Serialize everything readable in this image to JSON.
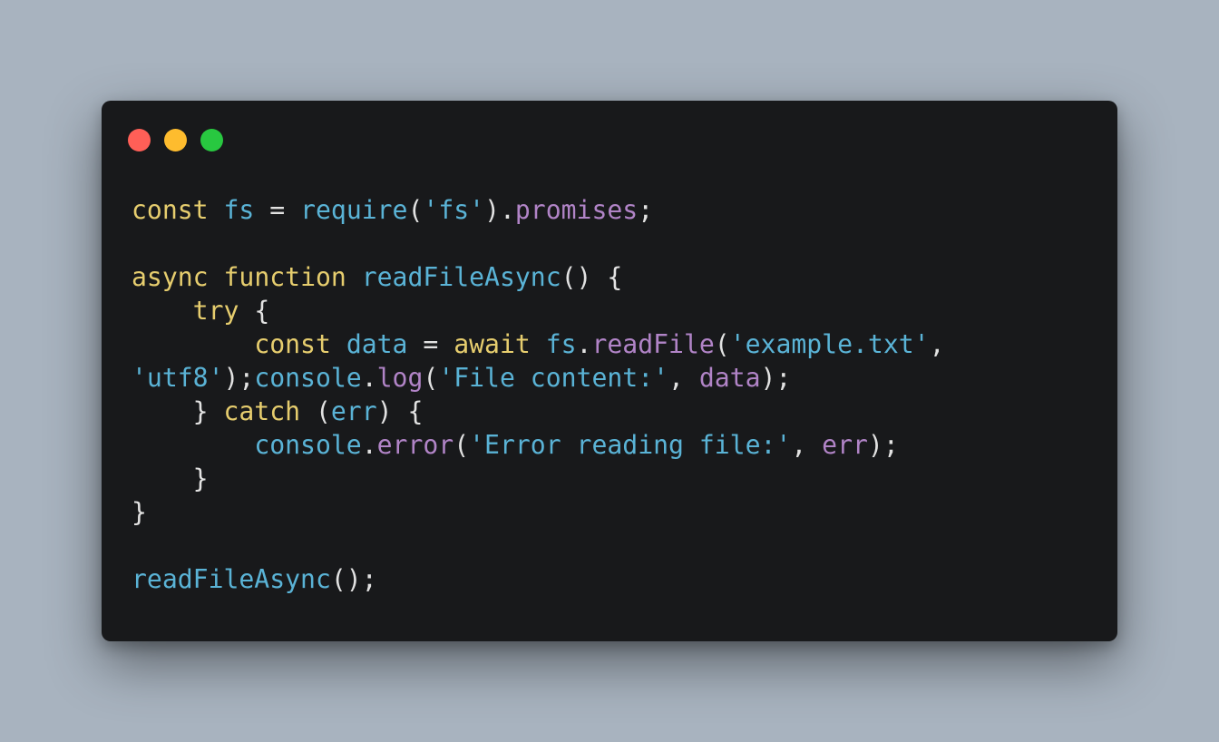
{
  "window": {
    "buttons": [
      {
        "name": "close",
        "color": "#ff5f57"
      },
      {
        "name": "minimize",
        "color": "#febc2e"
      },
      {
        "name": "zoom",
        "color": "#28c840"
      }
    ]
  },
  "colors": {
    "background": "#a8b3bf",
    "window": "#18191b",
    "keyword": "#e6cd6e",
    "identifier": "#5ab3d6",
    "property": "#b184c7",
    "punctuation": "#e2e2e2"
  },
  "code": {
    "lines": [
      [
        {
          "t": "const",
          "c": "kw"
        },
        {
          "t": " ",
          "c": "p"
        },
        {
          "t": "fs",
          "c": "id"
        },
        {
          "t": " = ",
          "c": "p"
        },
        {
          "t": "require",
          "c": "id"
        },
        {
          "t": "(",
          "c": "p"
        },
        {
          "t": "'fs'",
          "c": "id"
        },
        {
          "t": ").",
          "c": "p"
        },
        {
          "t": "promises",
          "c": "prop"
        },
        {
          "t": ";",
          "c": "p"
        }
      ],
      [],
      [
        {
          "t": "async",
          "c": "kw"
        },
        {
          "t": " ",
          "c": "p"
        },
        {
          "t": "function",
          "c": "kw"
        },
        {
          "t": " ",
          "c": "p"
        },
        {
          "t": "readFileAsync",
          "c": "id"
        },
        {
          "t": "() {",
          "c": "p"
        }
      ],
      [
        {
          "t": "    ",
          "c": "p"
        },
        {
          "t": "try",
          "c": "kw"
        },
        {
          "t": " {",
          "c": "p"
        }
      ],
      [
        {
          "t": "        ",
          "c": "p"
        },
        {
          "t": "const",
          "c": "kw"
        },
        {
          "t": " ",
          "c": "p"
        },
        {
          "t": "data",
          "c": "id"
        },
        {
          "t": " = ",
          "c": "p"
        },
        {
          "t": "await",
          "c": "kw"
        },
        {
          "t": " ",
          "c": "p"
        },
        {
          "t": "fs",
          "c": "id"
        },
        {
          "t": ".",
          "c": "p"
        },
        {
          "t": "readFile",
          "c": "prop"
        },
        {
          "t": "(",
          "c": "p"
        },
        {
          "t": "'example.txt'",
          "c": "id"
        },
        {
          "t": ",",
          "c": "p"
        }
      ],
      [
        {
          "t": "'utf8'",
          "c": "id"
        },
        {
          "t": ");",
          "c": "p"
        },
        {
          "t": "console",
          "c": "id"
        },
        {
          "t": ".",
          "c": "p"
        },
        {
          "t": "log",
          "c": "prop"
        },
        {
          "t": "(",
          "c": "p"
        },
        {
          "t": "'File content:'",
          "c": "id"
        },
        {
          "t": ", ",
          "c": "p"
        },
        {
          "t": "data",
          "c": "prop"
        },
        {
          "t": ");",
          "c": "p"
        }
      ],
      [
        {
          "t": "    } ",
          "c": "p"
        },
        {
          "t": "catch",
          "c": "kw"
        },
        {
          "t": " (",
          "c": "p"
        },
        {
          "t": "err",
          "c": "id"
        },
        {
          "t": ") {",
          "c": "p"
        }
      ],
      [
        {
          "t": "        ",
          "c": "p"
        },
        {
          "t": "console",
          "c": "id"
        },
        {
          "t": ".",
          "c": "p"
        },
        {
          "t": "error",
          "c": "prop"
        },
        {
          "t": "(",
          "c": "p"
        },
        {
          "t": "'Error reading file:'",
          "c": "id"
        },
        {
          "t": ", ",
          "c": "p"
        },
        {
          "t": "err",
          "c": "prop"
        },
        {
          "t": ");",
          "c": "p"
        }
      ],
      [
        {
          "t": "    }",
          "c": "p"
        }
      ],
      [
        {
          "t": "}",
          "c": "p"
        }
      ],
      [],
      [
        {
          "t": "readFileAsync",
          "c": "id"
        },
        {
          "t": "();",
          "c": "p"
        }
      ]
    ]
  }
}
